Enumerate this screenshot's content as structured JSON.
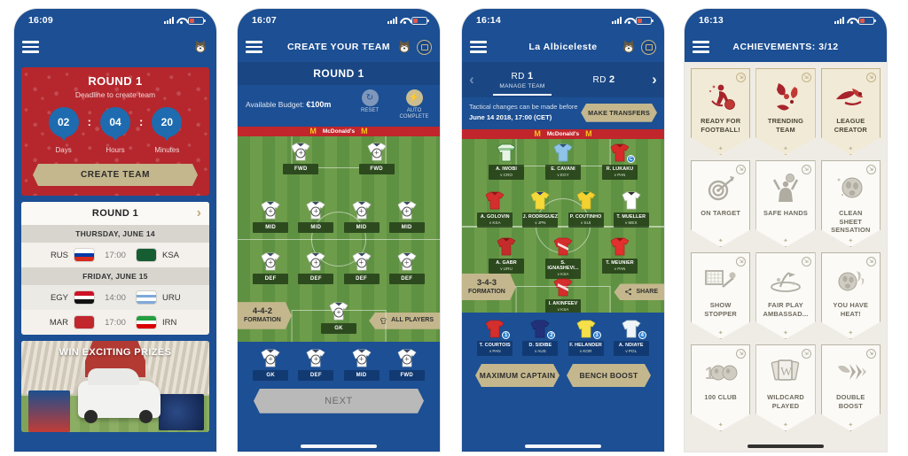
{
  "phones": [
    {
      "id": "home",
      "status": {
        "time": "16:09"
      },
      "nav": {
        "title": "",
        "menu_icon": "hamburger-icon",
        "mascot_icon": "mascot-wolf-icon"
      },
      "deadline": {
        "title": "ROUND 1",
        "subtitle": "Deadline to create team",
        "units": [
          {
            "value": "02",
            "label": "Days"
          },
          {
            "value": "04",
            "label": "Hours"
          },
          {
            "value": "20",
            "label": "Minutes"
          }
        ],
        "separator": ":",
        "cta": "CREATE TEAM",
        "bg_color": "#b5272d",
        "pill_color": "#1e6bb0"
      },
      "fixtures": {
        "header": "ROUND 1",
        "chevron_icon": "chevron-right-icon",
        "days": [
          {
            "label": "THURSDAY, JUNE 14",
            "matches": [
              {
                "home": "RUS",
                "away": "KSA",
                "time": "17:00"
              }
            ]
          },
          {
            "label": "FRIDAY, JUNE 15",
            "matches": [
              {
                "home": "EGY",
                "away": "URU",
                "time": "14:00"
              },
              {
                "home": "MAR",
                "away": "IRN",
                "time": "17:00"
              }
            ]
          }
        ]
      },
      "promo": {
        "title": "WIN EXCITING PRIZES"
      }
    },
    {
      "id": "create-team",
      "status": {
        "time": "16:07"
      },
      "nav": {
        "title": "CREATE YOUR TEAM"
      },
      "subtitle": "ROUND 1",
      "budget": {
        "label": "Available Budget:",
        "value": "€100m"
      },
      "actions": [
        {
          "label": "RESET",
          "icon": "reset-icon",
          "glyph": "↺"
        },
        {
          "label": "AUTO COMPLETE",
          "icon": "auto-complete-icon",
          "glyph": "⚡"
        }
      ],
      "adboard": "McDonald's",
      "formation": {
        "value": "4-4-2",
        "label": "FORMATION"
      },
      "all_players": {
        "label": "ALL PLAYERS",
        "icon": "jersey-icon"
      },
      "lineup": [
        {
          "row": "FWD",
          "slots": [
            "FWD",
            "FWD"
          ]
        },
        {
          "row": "MID",
          "slots": [
            "MID",
            "MID",
            "MID",
            "MID"
          ]
        },
        {
          "row": "DEF",
          "slots": [
            "DEF",
            "DEF",
            "DEF",
            "DEF"
          ]
        },
        {
          "row": "GK",
          "slots": [
            "GK"
          ]
        }
      ],
      "bench": [
        "GK",
        "DEF",
        "MID",
        "FWD"
      ],
      "next_label": "NEXT"
    },
    {
      "id": "manage-team",
      "status": {
        "time": "16:14"
      },
      "nav": {
        "title": "La Albiceleste"
      },
      "tabs": [
        {
          "prefix": "RD ",
          "num": "1",
          "sub": "MANAGE TEAM",
          "active": true
        },
        {
          "prefix": "RD ",
          "num": "2",
          "sub": "",
          "active": false
        }
      ],
      "prev_icon": "chevron-left-icon",
      "next_icon": "chevron-right-icon",
      "tactical": {
        "line1": "Tactical changes can be made before",
        "line2": "June 14 2018, 17:00 (CET)",
        "button": "MAKE TRANSFERS"
      },
      "adboard": "McDonald's",
      "formation": {
        "value": "3-4-3",
        "label": "FORMATION"
      },
      "share": {
        "label": "SHARE",
        "icon": "share-icon"
      },
      "rows": [
        {
          "players": [
            {
              "name": "A. IWOBI",
              "opp": "v CRO",
              "kit": "nigeria",
              "captain": false
            },
            {
              "name": "E. CAVANI",
              "opp": "v EGY",
              "kit": "uruguay",
              "captain": false
            },
            {
              "name": "R. LUKAKU",
              "opp": "v PAN",
              "kit": "belgium",
              "captain": true
            }
          ]
        },
        {
          "players": [
            {
              "name": "A. GOLOVIN",
              "opp": "v KSA",
              "kit": "russia",
              "captain": false
            },
            {
              "name": "J. RODRIGUEZ",
              "opp": "v JPN",
              "kit": "colombia",
              "captain": false
            },
            {
              "name": "P. COUTINHO",
              "opp": "v SUI",
              "kit": "brazil",
              "captain": false
            },
            {
              "name": "T. MUELLER",
              "opp": "v MEX",
              "kit": "germany",
              "captain": false
            }
          ]
        },
        {
          "players": [
            {
              "name": "A. GABR",
              "opp": "v URU",
              "kit": "egypt",
              "captain": false
            },
            {
              "name": "S. IGNASHEVI...",
              "opp": "v KSA",
              "kit": "russia",
              "captain": false
            },
            {
              "name": "T. MEUNIER",
              "opp": "v PAN",
              "kit": "belgium",
              "captain": false
            }
          ]
        },
        {
          "players": [
            {
              "name": "I. AKINFEEV",
              "opp": "v KSA",
              "kit": "russia-gk",
              "captain": false
            }
          ]
        }
      ],
      "bench": [
        {
          "name": "T. COURTOIS",
          "opp": "v PAN",
          "kit": "belgium"
        },
        {
          "name": "D. SIDIBE",
          "opp": "v AUS",
          "kit": "france"
        },
        {
          "name": "F. HELANDER",
          "opp": "v KOR",
          "kit": "sweden"
        },
        {
          "name": "A. NDIAYE",
          "opp": "v POL",
          "kit": "senegal"
        }
      ],
      "buttons": [
        "MAXIMUM CAPTAIN",
        "BENCH BOOST"
      ]
    },
    {
      "id": "achievements",
      "status": {
        "time": "16:13"
      },
      "nav": {
        "title": "ACHIEVEMENTS: 3/12"
      },
      "achievements": [
        {
          "label": "READY FOR FOOTBALL!",
          "unlocked": true,
          "icon": "player-kick-icon"
        },
        {
          "label": "TRENDING TEAM",
          "unlocked": true,
          "icon": "flames-icon"
        },
        {
          "label": "LEAGUE CREATOR",
          "unlocked": true,
          "icon": "league-swirl-icon"
        },
        {
          "label": "ON TARGET",
          "unlocked": false,
          "icon": "target-dart-icon"
        },
        {
          "label": "SAFE HANDS",
          "unlocked": false,
          "icon": "goalkeeper-catch-icon"
        },
        {
          "label": "CLEAN SHEET SENSATION",
          "unlocked": false,
          "icon": "ball-sparkle-icon"
        },
        {
          "label": "SHOW STOPPER",
          "unlocked": false,
          "icon": "goal-save-icon"
        },
        {
          "label": "FAIR PLAY AMBASSAD...",
          "unlocked": false,
          "icon": "fair-play-icon"
        },
        {
          "label": "YOU HAVE HEAT!",
          "unlocked": false,
          "icon": "flaming-ball-icon"
        },
        {
          "label": "100 CLUB",
          "unlocked": false,
          "icon": "hundred-balls-icon"
        },
        {
          "label": "WILDCARD PLAYED",
          "unlocked": false,
          "icon": "wildcard-icon"
        },
        {
          "label": "DOUBLE BOOST",
          "unlocked": false,
          "icon": "double-arrow-icon"
        }
      ]
    }
  ]
}
